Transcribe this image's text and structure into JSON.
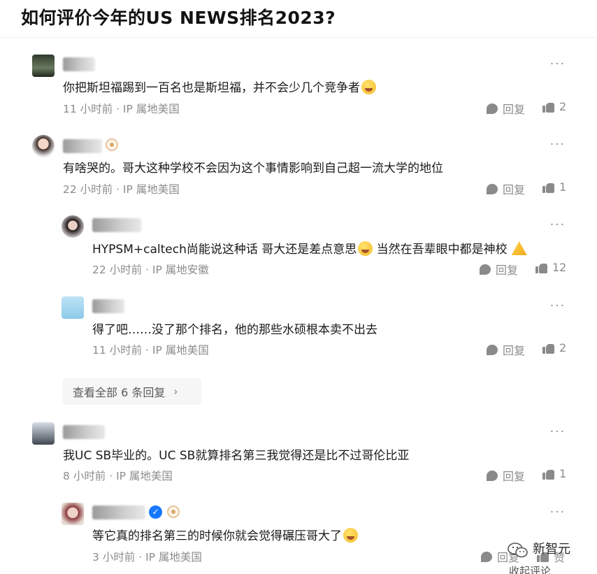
{
  "page_title": "如何评价今年的US NEWS排名2023?",
  "ui": {
    "more": "···",
    "reply": "回复",
    "view_all": "查看全部 6 条回复",
    "chevron": "›"
  },
  "comments": [
    {
      "text": "你把斯坦福踢到一百名也是斯坦福，并不会少几个竞争者",
      "emoji": true,
      "meta": "11 小时前 · IP 属地美国",
      "likes": "2"
    },
    {
      "text": "有啥哭的。哥大这种学校不会因为这个事情影响到自己超一流大学的地位",
      "meta": "22 小时前 · IP 属地美国",
      "likes": "1"
    },
    {
      "text": "HYPSM+caltech尚能说这种话 哥大还是差点意思",
      "text2": " 当然在吾辈眼中都是神校",
      "meta": "22 小时前 · IP 属地安徽",
      "likes": "12"
    },
    {
      "text": "得了吧……没了那个排名，他的那些水硕根本卖不出去",
      "meta": "11 小时前 · IP 属地美国",
      "likes": "2"
    },
    {
      "text": "我UC SB毕业的。UC SB就算排名第三我觉得还是比不过哥伦比亚",
      "meta": "8 小时前 · IP 属地美国",
      "likes": "1"
    },
    {
      "text": "等它真的排名第三的时候你就会觉得碾压哥大了",
      "meta": "3 小时前 · IP 属地美国",
      "likes": "赞"
    }
  ],
  "watermark": {
    "text": "新智元",
    "icon": "wechat-icon"
  },
  "footer_cut": "收起评论"
}
